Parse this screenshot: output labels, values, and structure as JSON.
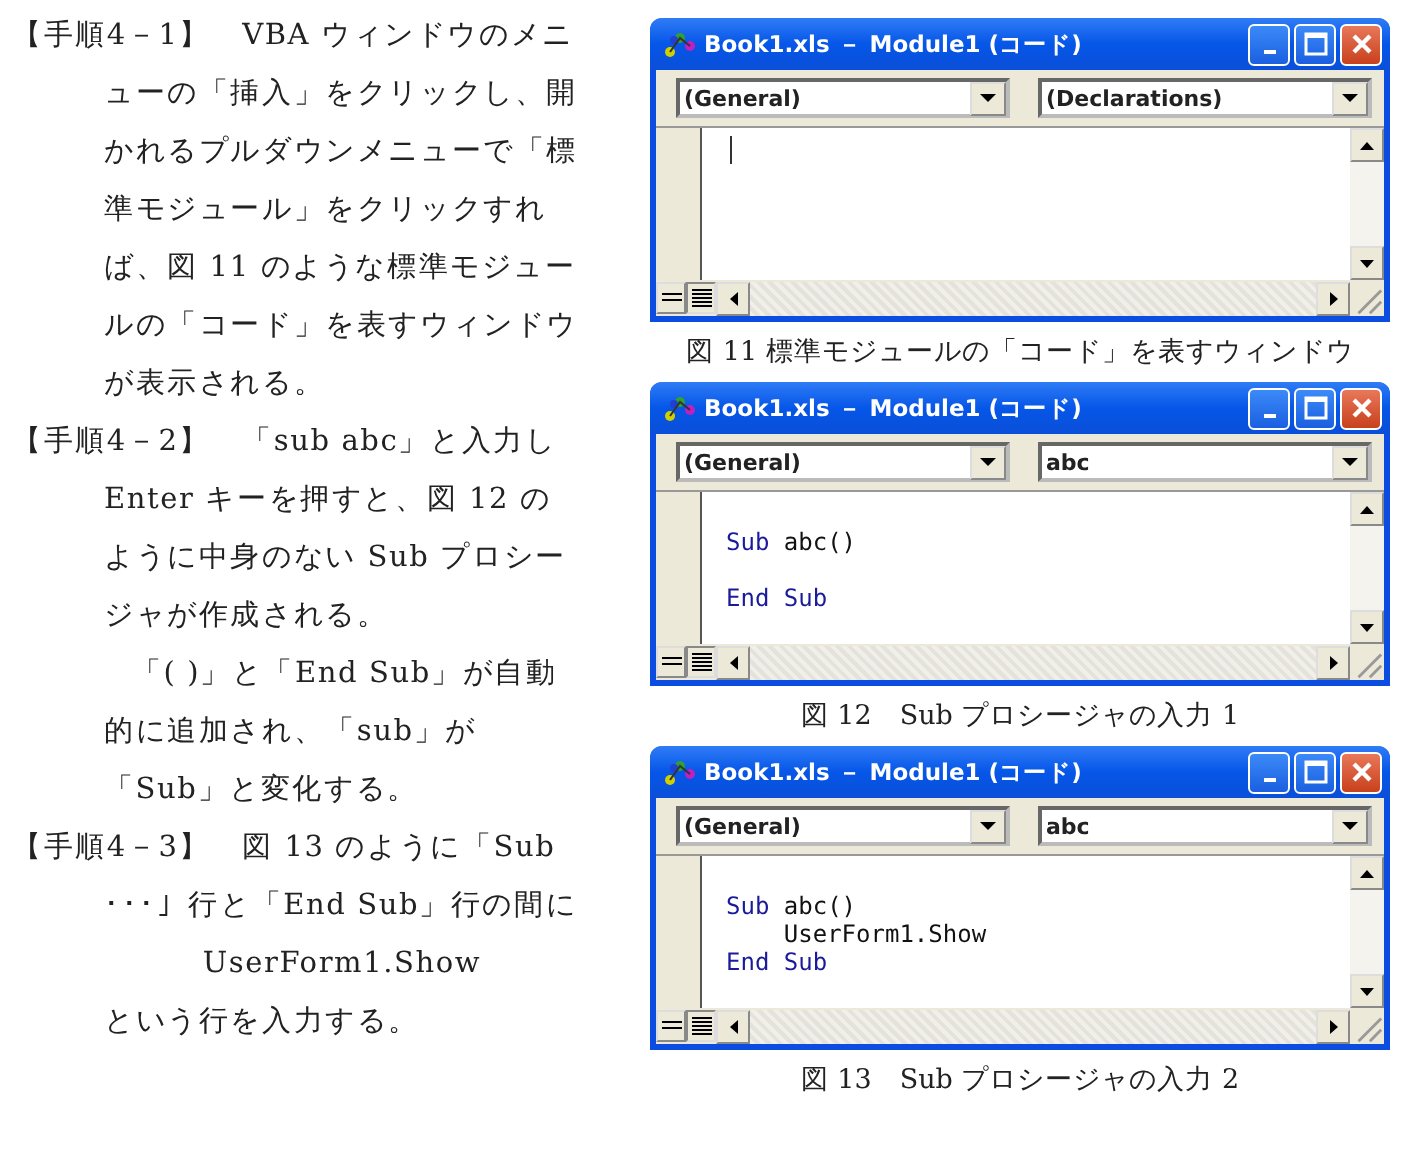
{
  "steps": [
    {
      "label": "【手順4－1】",
      "paragraphs": [
        {
          "kind": "text",
          "text": "VBA ウィンドウのメニューの「挿入」をクリックし、開かれるプルダウンメニューで「標準モジュール」をクリックすれば、図 11 のような標準モジュールの「コード」を表すウィンドウが表示される。"
        }
      ]
    },
    {
      "label": "【手順4－2】",
      "paragraphs": [
        {
          "kind": "text",
          "text": "「sub abc」と入力し Enter キーを押すと、図 12 のように中身のない Sub プロシージャが作成される。"
        },
        {
          "kind": "note",
          "text": "「( )」と「End Sub」が自動的に追加され、「sub」が「Sub」と変化する。"
        }
      ]
    },
    {
      "label": "【手順4－3】",
      "paragraphs": [
        {
          "kind": "text",
          "text": "図 13 のように「Sub ･･･」行と「End Sub」行の間に"
        },
        {
          "kind": "code",
          "text": "UserForm1.Show"
        },
        {
          "kind": "note_plain",
          "text": "という行を入力する。"
        }
      ]
    }
  ],
  "figures": [
    {
      "window": {
        "title": "Book1.xls － Module1 (コード)",
        "object_dropdown": "(General)",
        "procedure_dropdown": "(Declarations)",
        "caret": true
      },
      "caption": "図 11 標準モジュールの「コード」を表すウィンドウ"
    },
    {
      "window": {
        "title": "Book1.xls － Module1 (コード)",
        "object_dropdown": "(General)",
        "procedure_dropdown": "abc",
        "caret": false,
        "lines": [
          {
            "kind": "code",
            "tokens": [
              {
                "text": "Sub",
                "keyword": true
              },
              {
                "text": " abc()",
                "keyword": false
              }
            ]
          },
          {
            "kind": "blank"
          },
          {
            "kind": "code",
            "tokens": [
              {
                "text": "End Sub",
                "keyword": true
              }
            ]
          }
        ]
      },
      "caption": "図 12　Sub プロシージャの入力 1"
    },
    {
      "window": {
        "title": "Book1.xls － Module1 (コード)",
        "object_dropdown": "(General)",
        "procedure_dropdown": "abc",
        "caret": false,
        "lines": [
          {
            "kind": "code",
            "tokens": [
              {
                "text": "Sub",
                "keyword": true
              },
              {
                "text": " abc()",
                "keyword": false
              }
            ]
          },
          {
            "kind": "code",
            "tokens": [
              {
                "text": "    UserForm1.Show",
                "keyword": false
              }
            ]
          },
          {
            "kind": "code",
            "tokens": [
              {
                "text": "End Sub",
                "keyword": true
              }
            ]
          }
        ]
      },
      "caption": "図 13　Sub プロシージャの入力 2"
    }
  ]
}
